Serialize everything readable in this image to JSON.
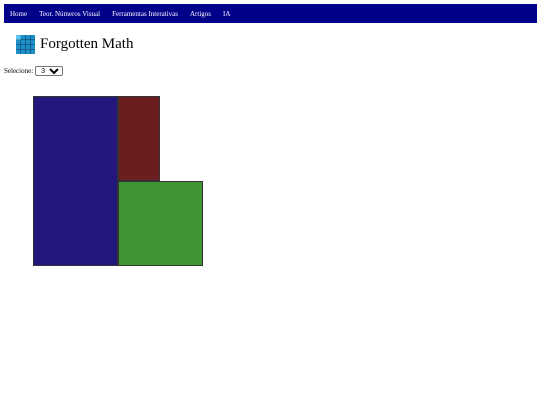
{
  "nav": {
    "items": [
      {
        "label": "Home"
      },
      {
        "label": "Teor. Números Visual"
      },
      {
        "label": "Ferramentas Interativas"
      },
      {
        "label": "Artigos"
      },
      {
        "label": "IA"
      }
    ],
    "background": "#00008b"
  },
  "header": {
    "title": "Forgotten Math",
    "logo_icon": "grid-logo-icon",
    "logo_color": "#1e90c8"
  },
  "selector": {
    "label": "Selecione:",
    "value": "3"
  },
  "squares": {
    "colors": [
      "#23177e",
      "#6b1e1f",
      "#3f9536"
    ]
  }
}
